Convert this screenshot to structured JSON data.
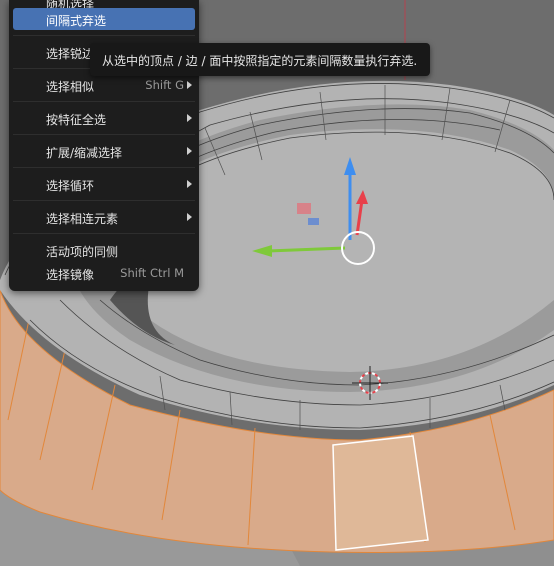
{
  "menu": {
    "items": [
      {
        "label": "随机选择",
        "shortcut": "",
        "has_submenu": false
      },
      {
        "label": "间隔式弃选",
        "shortcut": "",
        "has_submenu": false,
        "highlighted": true
      },
      {
        "label": "选择锐边",
        "shortcut": "",
        "has_submenu": false
      },
      {
        "label": "选择相似",
        "shortcut": "Shift G",
        "has_submenu": true
      },
      {
        "label": "按特征全选",
        "shortcut": "",
        "has_submenu": true
      },
      {
        "label": "扩展/缩减选择",
        "shortcut": "",
        "has_submenu": true
      },
      {
        "label": "选择循环",
        "shortcut": "",
        "has_submenu": true
      },
      {
        "label": "选择相连元素",
        "shortcut": "",
        "has_submenu": true
      },
      {
        "label": "活动项的同侧",
        "shortcut": "",
        "has_submenu": false
      },
      {
        "label": "选择镜像",
        "shortcut": "Shift Ctrl M",
        "has_submenu": false
      }
    ]
  },
  "tooltip": {
    "text": "从选中的顶点 / 边 / 面中按照指定的元素间隔数量执行弃选."
  },
  "viewport": {
    "background": "#6e6e6e",
    "mesh_color": "#a3a3a3",
    "selected_face_color": "#d8a886",
    "selected_edge_color": "#e2873a",
    "axis_z_color": "#3e8ef0",
    "axis_x_color": "#e8404a",
    "axis_y_color": "#7fc93a",
    "active_face_outline": "#ffffff"
  },
  "icons": [
    "3d-cursor-icon",
    "gizmo-z-arrow-icon",
    "gizmo-x-arrow-icon",
    "gizmo-y-arrow-icon",
    "pivot-circle-icon",
    "submenu-arrow-icon"
  ]
}
